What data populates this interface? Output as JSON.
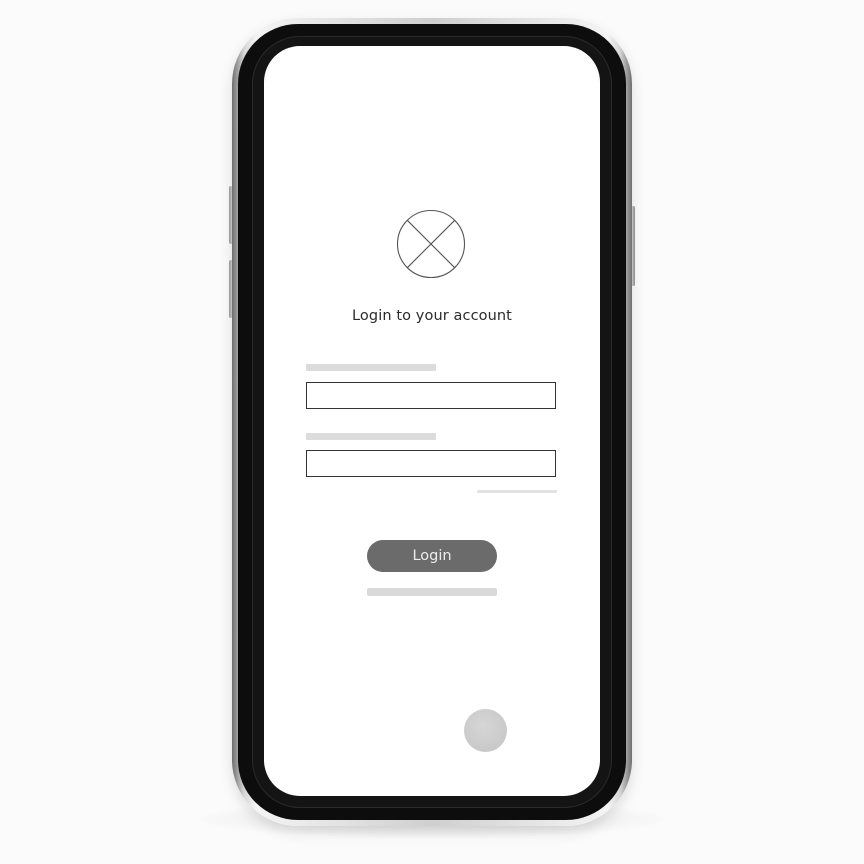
{
  "device": {
    "type": "smartphone mockup"
  },
  "screen": {
    "logo_icon": "image-placeholder-icon",
    "title": "Login to your account",
    "username": {
      "label_placeholder": "",
      "value": "",
      "placeholder": ""
    },
    "password": {
      "label_placeholder": "",
      "value": "",
      "placeholder": ""
    },
    "login_button_label": "Login",
    "home_button_icon": "circle-button-icon"
  },
  "colors": {
    "button_background": "#6b6b6b",
    "button_text": "#ececec",
    "placeholder_bar": "#dcdcdc",
    "field_border": "#333333",
    "frame": "#0d0d0d"
  }
}
